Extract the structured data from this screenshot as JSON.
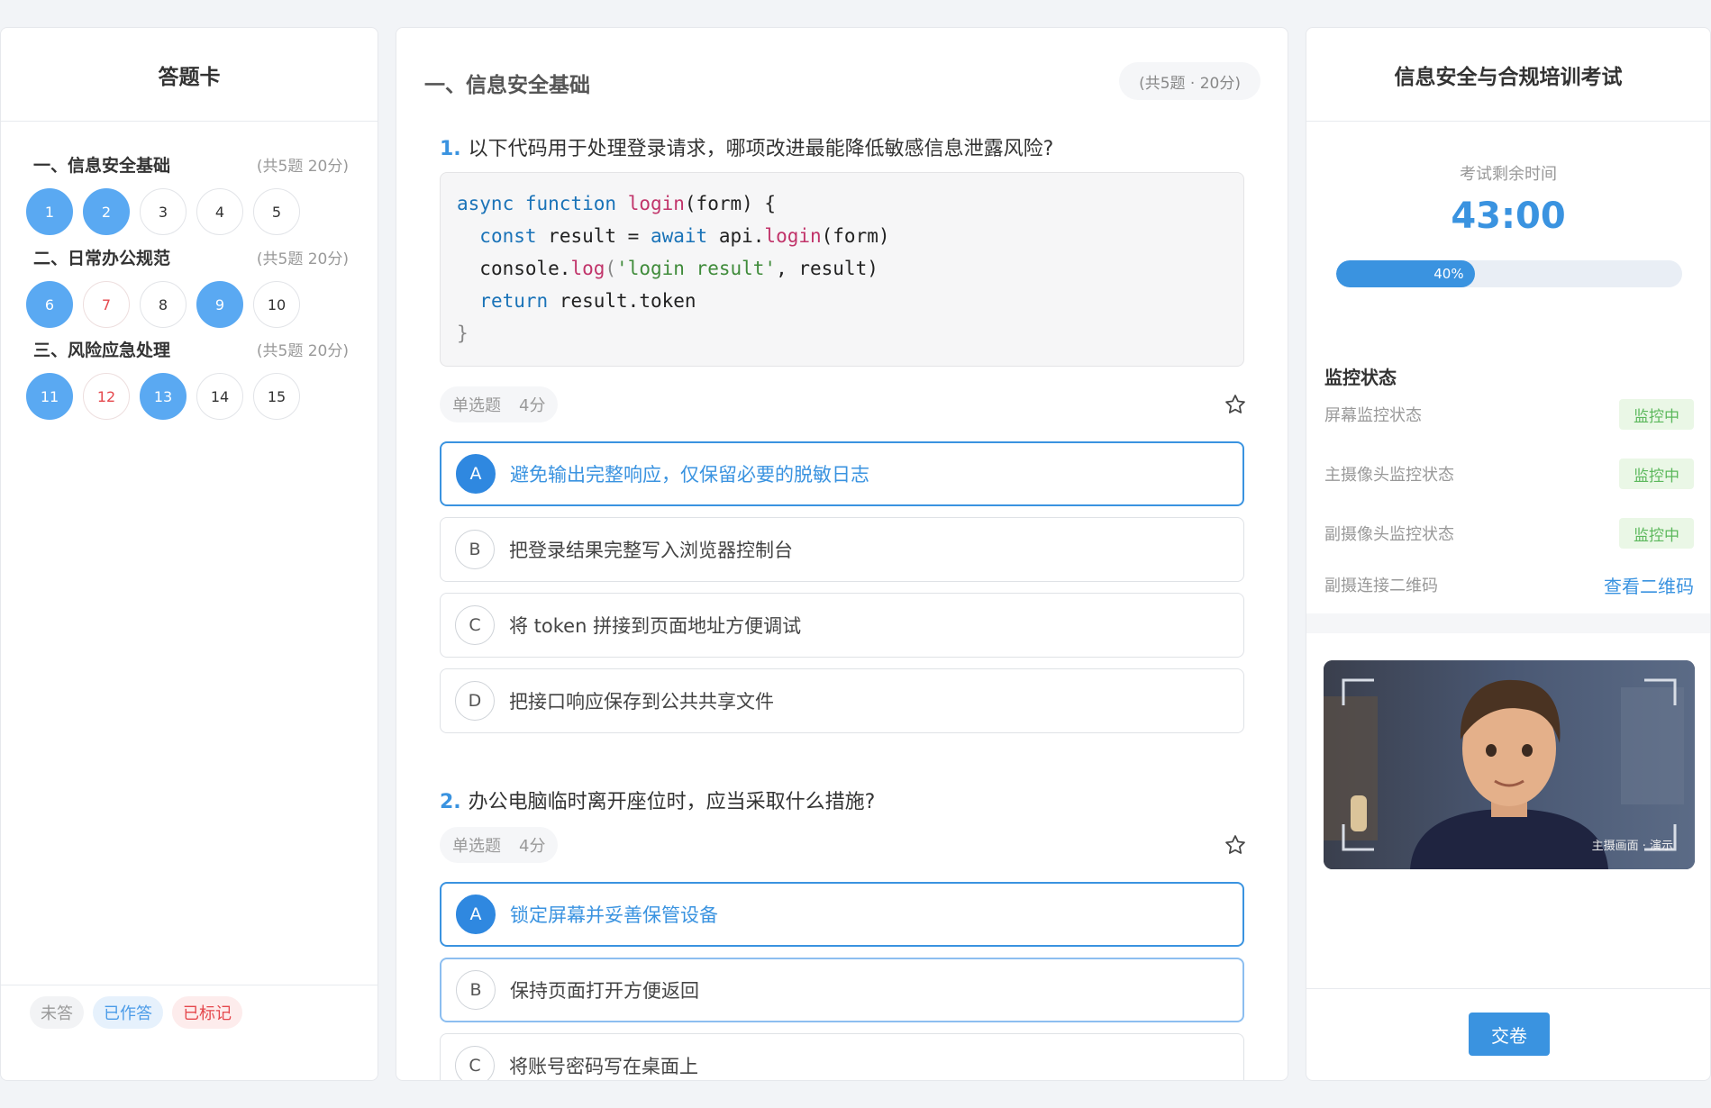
{
  "answer_card": {
    "title": "答题卡",
    "sections": [
      {
        "title": "一、信息安全基础",
        "sub": "(共5题 20分)",
        "numbers": [
          "1",
          "2",
          "3",
          "4",
          "5"
        ],
        "states": [
          "answered",
          "answered",
          "",
          "",
          ""
        ]
      },
      {
        "title": "二、日常办公规范",
        "sub": "(共5题 20分)",
        "numbers": [
          "6",
          "7",
          "8",
          "9",
          "10"
        ],
        "states": [
          "answered",
          "marked",
          "",
          "answered",
          ""
        ]
      },
      {
        "title": "三、风险应急处理",
        "sub": "(共5题 20分)",
        "numbers": [
          "11",
          "12",
          "13",
          "14",
          "15"
        ],
        "states": [
          "answered",
          "marked",
          "answered",
          "",
          ""
        ]
      }
    ],
    "legend": {
      "unanswered": "未答",
      "answered": "已作答",
      "marked": "已标记"
    }
  },
  "section": {
    "title": "一、信息安全基础",
    "badge": "(共5题 · 20分)"
  },
  "questions": [
    {
      "number": "1.",
      "text": "以下代码用于处理登录请求，哪项改进最能降低敏感信息泄露风险?",
      "type": "单选题",
      "score": "4分",
      "code": {
        "l1_kw1": "async",
        "l1_kw2": "function",
        "l1_fn": "login",
        "l1_rest": "(form) {",
        "l2_kw": "const",
        "l2_mid": "result = ",
        "l2_kw2": "await",
        "l2_obj": "api.",
        "l2_fn": "login",
        "l2_rest": "(form)",
        "l3_obj": "console.",
        "l3_fn": "log",
        "l3_p1": "(",
        "l3_str": "'login result'",
        "l3_rest": ", result)",
        "l4_kw": "return",
        "l4_rest": "result.token",
        "l5": "}"
      },
      "options": [
        {
          "letter": "A",
          "text": "避免输出完整响应，仅保留必要的脱敏日志"
        },
        {
          "letter": "B",
          "text": "把登录结果完整写入浏览器控制台"
        },
        {
          "letter": "C",
          "text": "将 token 拼接到页面地址方便调试"
        },
        {
          "letter": "D",
          "text": "把接口响应保存到公共共享文件"
        }
      ]
    },
    {
      "number": "2.",
      "text": "办公电脑临时离开座位时，应当采取什么措施?",
      "type": "单选题",
      "score": "4分",
      "options": [
        {
          "letter": "A",
          "text": "锁定屏幕并妥善保管设备"
        },
        {
          "letter": "B",
          "text": "保持页面打开方便返回"
        },
        {
          "letter": "C",
          "text": "将账号密码写在桌面上"
        }
      ]
    }
  ],
  "exam": {
    "title": "信息安全与合规培训考试",
    "timer_label": "考试剩余时间",
    "timer": "43:00",
    "progress_percent": 40,
    "progress_label": "40%",
    "monitor_title": "监控状态",
    "monitors": [
      {
        "label": "屏幕监控状态",
        "status": "监控中"
      },
      {
        "label": "主摄像头监控状态",
        "status": "监控中"
      },
      {
        "label": "副摄像头监控状态",
        "status": "监控中"
      }
    ],
    "qr_label": "副摄连接二维码",
    "qr_link": "查看二维码",
    "camera_caption": "主摄画面 · 演示",
    "submit": "交卷"
  },
  "colors": {
    "accent": "#3a93e0",
    "answered": "#5aa9f2",
    "marked": "#e5484d",
    "ok": "#5cb85c"
  }
}
